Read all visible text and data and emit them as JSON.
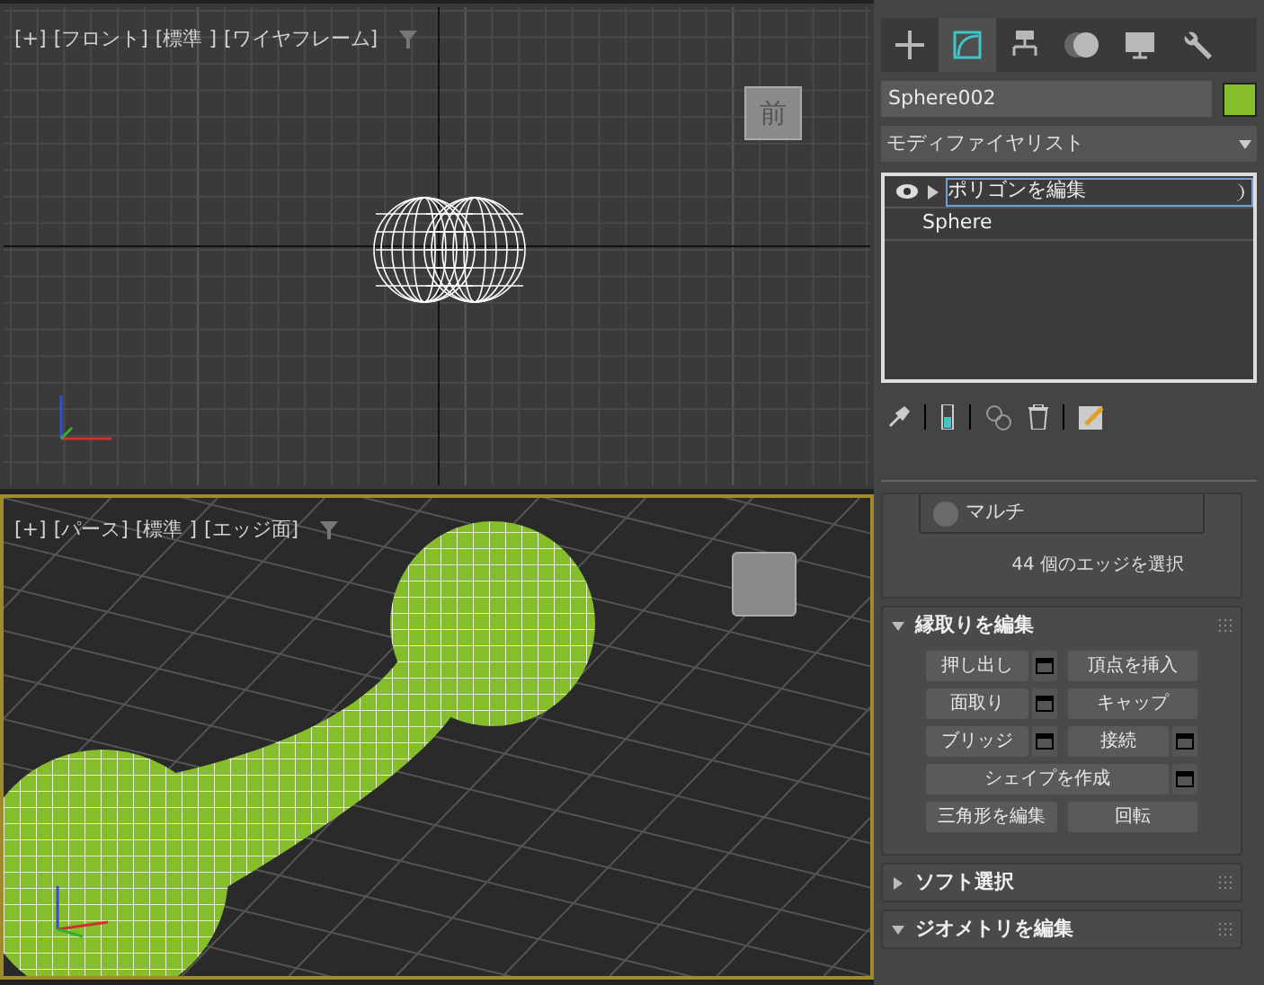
{
  "viewports": [
    {
      "kind": "ortho",
      "labels": [
        "[+]",
        "[フロント]",
        "[標準 ]",
        "[ワイヤフレーム]"
      ],
      "active": false,
      "viewcube": "前"
    },
    {
      "kind": "perspective",
      "labels": [
        "[+]",
        "[パース]",
        "[標準 ]",
        "[エッジ面]"
      ],
      "active": true
    }
  ],
  "command_tabs": [
    {
      "kind": "create",
      "selected": false
    },
    {
      "kind": "modify",
      "selected": true
    },
    {
      "kind": "hierarchy",
      "selected": false
    },
    {
      "kind": "motion",
      "selected": false
    },
    {
      "kind": "display",
      "selected": false
    },
    {
      "kind": "utilities",
      "selected": false
    }
  ],
  "object": {
    "name": "Sphere002",
    "color": "#86bd2b"
  },
  "modifier_list": {
    "value": "モディファイヤリスト"
  },
  "modifier_stack": [
    {
      "kind": "modifier",
      "label": "ポリゴンを編集",
      "selected": true
    },
    {
      "kind": "base",
      "label": "Sphere",
      "selected": false
    }
  ],
  "selection": {
    "radio": {
      "label": "マルチ",
      "selected": false
    },
    "count": "44",
    "status": "個のエッジを選択"
  },
  "rollouts": [
    {
      "title": "縁取りを編集",
      "expanded": true,
      "buttons": [
        {
          "label": "押し出し",
          "settings": true
        },
        {
          "label": "頂点を挿入",
          "settings": false
        },
        {
          "label": "面取り",
          "settings": true
        },
        {
          "label": "キャップ",
          "settings": false
        },
        {
          "label": "ブリッジ",
          "settings": true
        },
        {
          "label": "接続",
          "settings": true
        },
        {
          "label": "シェイプを作成",
          "settings": true,
          "wide": true
        },
        {
          "label": "三角形を編集",
          "settings": false
        },
        {
          "label": "回転",
          "settings": false
        }
      ]
    },
    {
      "title": "ソフト選択",
      "expanded": false
    },
    {
      "title": "ジオメトリを編集",
      "expanded": true
    }
  ]
}
